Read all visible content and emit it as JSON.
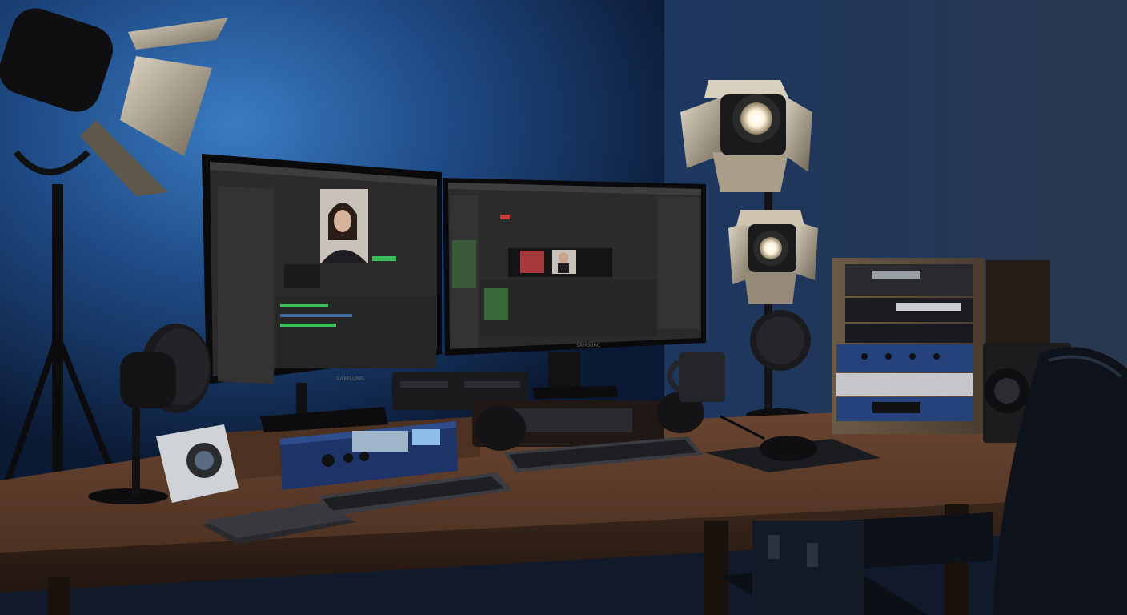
{
  "scene": {
    "palette": {
      "wall_light": "#2f6fb0",
      "wall_mid": "#1d4680",
      "wall_dark": "#0d1d3a",
      "desk_top": "#5a3b29",
      "desk_edge": "#3a2519",
      "ui_dark": "#2b2b2b",
      "ui_panel": "#3a3a3a",
      "rack_blue": "#26427d",
      "lamp_glow": "#fff6e0"
    },
    "monitors": [
      {
        "label": "SAMSUNG",
        "app": "video-editor",
        "preview": "presenter"
      },
      {
        "label": "SAMSUNG",
        "app": "video-editor",
        "preview": "two-shot"
      }
    ]
  }
}
